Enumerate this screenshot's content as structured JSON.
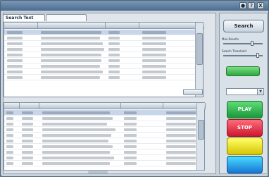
{
  "window": {
    "title": "",
    "menu_icon": "●",
    "help_icon": "?",
    "close_icon": "X"
  },
  "search": {
    "tab_label": "Search Text",
    "query": "",
    "button_label": "Search"
  },
  "controls": {
    "max_results_label": "Max Results",
    "search_threshold_label": "Search Threshold",
    "max_results_level": 0.75,
    "search_threshold_level": 0.9
  },
  "buttons": {
    "play_label": "PLAY",
    "stop_label": "STOP",
    "yellow_label": "",
    "blue_label": ""
  },
  "colors": {
    "accent": "#4e7094",
    "play": "#19983a",
    "stop": "#cc1730",
    "yellow": "#d5c400",
    "blue": "#1776d4"
  }
}
